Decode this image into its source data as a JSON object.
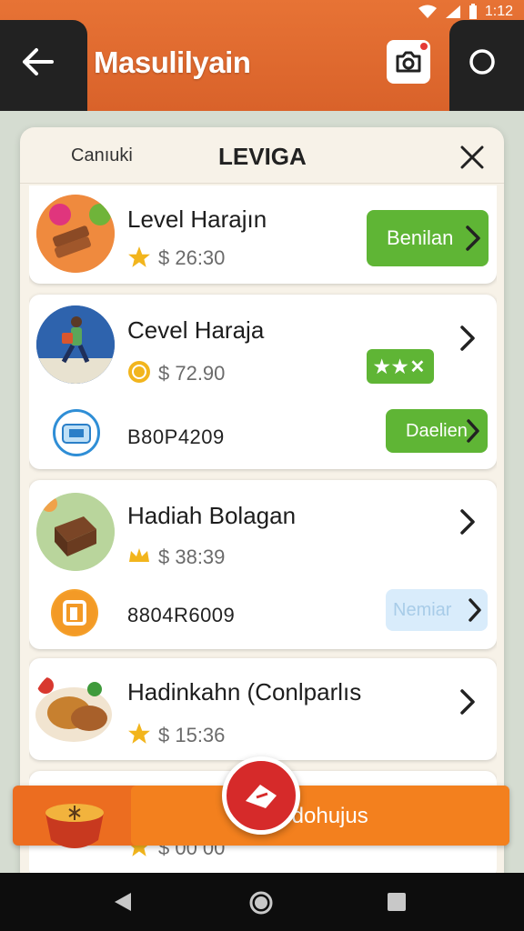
{
  "status_bar": {
    "time": "1:12"
  },
  "header": {
    "title": "Masulilyain"
  },
  "panel": {
    "left_label": "Canıuki",
    "title": "LEVIGA"
  },
  "items": [
    {
      "title": "Level Harajın",
      "price": "$ 26:30",
      "button": "Benilan"
    },
    {
      "title": "Cevel Haraja",
      "price": "$ 72.90",
      "badge": "★★✕",
      "code": "B80P4209",
      "button": "Daelien"
    },
    {
      "title": "Hadiah Bolagan",
      "price": "$ 38:39",
      "code": "8804R6009",
      "button": "Nemiar"
    },
    {
      "title": "Hadinkahn (Conlparlıs",
      "price": "$ 15:36"
    },
    {
      "price": "$ 00 00"
    }
  ],
  "bottom": {
    "label": "ıdohujus"
  },
  "colors": {
    "accent": "#e36b2c",
    "green": "#5fb535",
    "fab": "#d62a2a"
  }
}
